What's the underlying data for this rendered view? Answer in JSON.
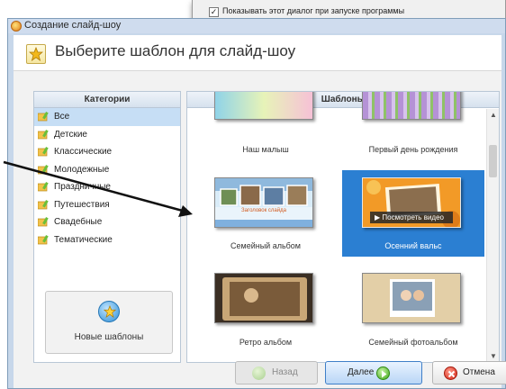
{
  "background_dialog": {
    "checkbox_checked": true,
    "checkbox_label": "Показывать этот диалог при запуске программы"
  },
  "window": {
    "title": "Создание слайд-шоу"
  },
  "header": {
    "title": "Выберите шаблон для слайд-шоу",
    "icon": "star-template-icon"
  },
  "categories": {
    "header": "Категории",
    "items": [
      {
        "label": "Все",
        "selected": true
      },
      {
        "label": "Детские",
        "selected": false
      },
      {
        "label": "Классические",
        "selected": false
      },
      {
        "label": "Молодежные",
        "selected": false
      },
      {
        "label": "Праздничные",
        "selected": false
      },
      {
        "label": "Путешествия",
        "selected": false
      },
      {
        "label": "Свадебные",
        "selected": false
      },
      {
        "label": "Тематические",
        "selected": false
      }
    ],
    "new_templates_label": "Новые шаблоны"
  },
  "templates": {
    "header": "Шаблоны",
    "items": [
      {
        "caption": "Наш малыш",
        "selected": false
      },
      {
        "caption": "Первый день рождения",
        "selected": false
      },
      {
        "caption": "Семейный альбом",
        "selected": false,
        "thumb_text": "Заголовок слайда"
      },
      {
        "caption": "Осенний вальс",
        "selected": true,
        "video_button": "Посмотреть видео"
      },
      {
        "caption": "Ретро альбом",
        "selected": false
      },
      {
        "caption": "Семейный фотоальбом",
        "selected": false
      }
    ]
  },
  "footer": {
    "back_label": "Назад",
    "next_label": "Далее",
    "cancel_label": "Отмена"
  },
  "colors": {
    "selection": "#2b7fd2",
    "category_selected": "#c6def5",
    "next_accent": "#3da515",
    "cancel_accent": "#d32212"
  }
}
